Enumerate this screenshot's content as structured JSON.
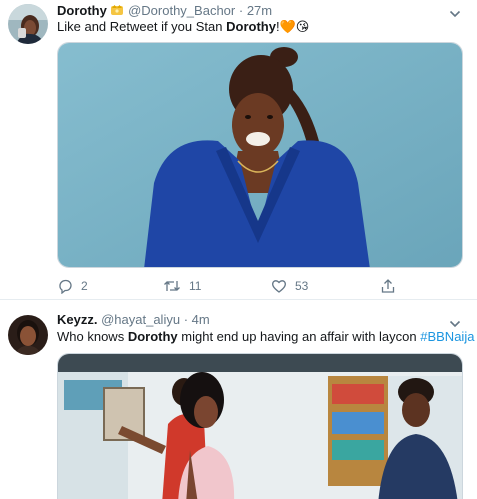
{
  "tweets": [
    {
      "display_name": "Dorothy",
      "handle": "@Dorothy_Bachor",
      "separator": "·",
      "time": "27m",
      "text_before": "Like and Retweet if you Stan ",
      "text_bold": "Dorothy",
      "text_after": "!🧡😘",
      "actions": {
        "reply": "2",
        "retweet": "11",
        "like": "53"
      }
    },
    {
      "display_name": "Keyzz.",
      "handle": "@hayat_aliyu",
      "separator": "·",
      "time": "4m",
      "text_before": "Who knows ",
      "text_bold": "Dorothy",
      "text_after": " might end up having an affair with laycon ",
      "hashtag": "#BBNaija"
    }
  ],
  "colors": {
    "link": "#1b95e0",
    "secondary": "#657786",
    "border": "#e6ecf0",
    "photo_1_backdrop": "#7fb6c9",
    "dress": "#1f46a6"
  },
  "icons": [
    "chevron-down-icon",
    "verified-crown-emoji",
    "reply-icon",
    "retweet-icon",
    "like-icon",
    "share-icon"
  ]
}
